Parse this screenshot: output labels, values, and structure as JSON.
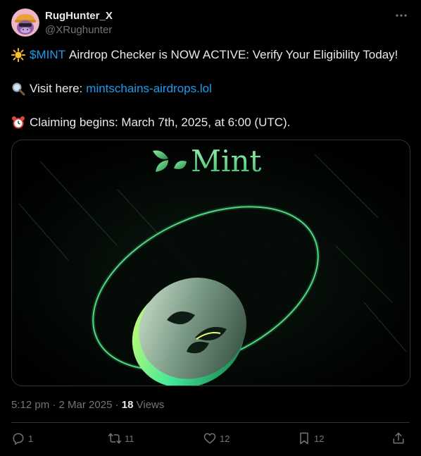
{
  "author": {
    "display_name": "RugHunter_X",
    "handle": "@XRughunter"
  },
  "tweet": {
    "line1_cashtag": "$MINT",
    "line1_text": "Airdrop Checker is NOW ACTIVE: Verify Your Eligibility Today!",
    "line2_text": "Visit here:",
    "line2_link": "mintschains-airdrops.lol",
    "line3_text": "Claiming begins: March 7th, 2025, at 6:00 (UTC).",
    "emojis": [
      "sun-emoji",
      "magnifier-emoji",
      "alarm-clock-emoji"
    ]
  },
  "media": {
    "brand_text": "Mint",
    "icon": "mint-leaf-icon"
  },
  "meta": {
    "time": "5:12 pm",
    "separator": "·",
    "date": "2 Mar 2025",
    "views_count": "18",
    "views_label": "Views"
  },
  "actions": {
    "reply_count": "1",
    "retweet_count": "11",
    "like_count": "12",
    "bookmark_count": "12"
  },
  "colors": {
    "background": "#000000",
    "text": "#e7e9ea",
    "muted": "#71767b",
    "link": "#1d9bf0",
    "border": "#2f3336",
    "mint_green": "#3fd17a"
  }
}
